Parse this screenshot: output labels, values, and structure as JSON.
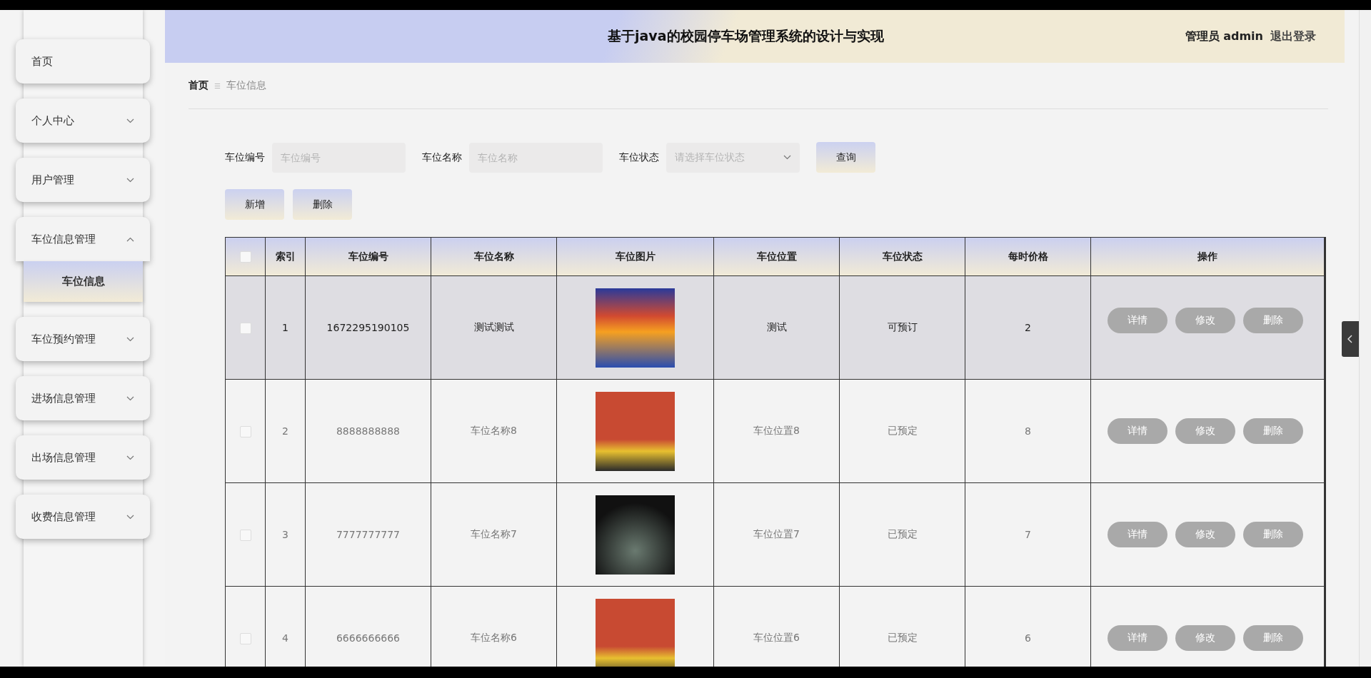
{
  "header": {
    "title": "基于java的校园停车场管理系统的设计与实现",
    "user": "管理员 admin",
    "logout": "退出登录"
  },
  "sidebar": {
    "items": [
      {
        "label": "首页",
        "expandable": false,
        "expanded": false
      },
      {
        "label": "个人中心",
        "expandable": true,
        "expanded": false
      },
      {
        "label": "用户管理",
        "expandable": true,
        "expanded": false
      },
      {
        "label": "车位信息管理",
        "expandable": true,
        "expanded": true,
        "children": [
          {
            "label": "车位信息",
            "selected": true
          }
        ]
      },
      {
        "label": "车位预约管理",
        "expandable": true,
        "expanded": false
      },
      {
        "label": "进场信息管理",
        "expandable": true,
        "expanded": false
      },
      {
        "label": "出场信息管理",
        "expandable": true,
        "expanded": false
      },
      {
        "label": "收费信息管理",
        "expandable": true,
        "expanded": false
      }
    ]
  },
  "breadcrumb": {
    "home": "首页",
    "separator": "☰",
    "current": "车位信息"
  },
  "search": {
    "fields": [
      {
        "kind": "input",
        "label": "车位编号",
        "placeholder": "车位编号"
      },
      {
        "kind": "input",
        "label": "车位名称",
        "placeholder": "车位名称"
      },
      {
        "kind": "select",
        "label": "车位状态",
        "placeholder": "请选择车位状态"
      }
    ],
    "button": "查询"
  },
  "actions": [
    "新增",
    "删除"
  ],
  "table": {
    "select_all_checked": false,
    "columns": [
      "索引",
      "车位编号",
      "车位名称",
      "车位图片",
      "车位位置",
      "车位状态",
      "每时价格",
      "操作"
    ],
    "rows": [
      {
        "checked": false,
        "highlighted": true,
        "index": "1",
        "number": "1672295190105",
        "name": "测试测试",
        "location": "测试",
        "status": "可预订",
        "price": "2",
        "buttons": [
          "详情",
          "修改",
          "删除"
        ]
      },
      {
        "checked": false,
        "highlighted": false,
        "index": "2",
        "number": "8888888888",
        "name": "车位名称8",
        "location": "车位位置8",
        "status": "已预定",
        "price": "8",
        "buttons": [
          "详情",
          "修改",
          "删除"
        ]
      },
      {
        "checked": false,
        "highlighted": false,
        "index": "3",
        "number": "7777777777",
        "name": "车位名称7",
        "location": "车位位置7",
        "status": "已预定",
        "price": "7",
        "buttons": [
          "详情",
          "修改",
          "删除"
        ]
      },
      {
        "checked": false,
        "highlighted": false,
        "index": "4",
        "number": "6666666666",
        "name": "车位名称6",
        "location": "车位位置6",
        "status": "已预定",
        "price": "6",
        "buttons": [
          "详情",
          "修改",
          "删除"
        ]
      }
    ]
  }
}
